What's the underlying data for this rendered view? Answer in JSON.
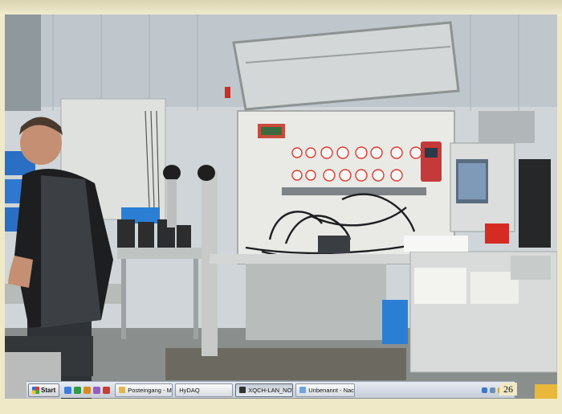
{
  "taskbar": {
    "start_label": "Start",
    "buttons": [
      {
        "label": "Posteingang - Mic...",
        "icon": "folder-icon",
        "active": false
      },
      {
        "label": "HyDAQ",
        "icon": "app-icon",
        "active": false
      },
      {
        "label": "XQCH-LAN_NOV...",
        "icon": "play-icon",
        "active": true
      },
      {
        "label": "Unbenannt - Nac...",
        "icon": "notepad-icon",
        "active": false
      }
    ]
  },
  "page_number": "26",
  "colors": {
    "slide_background": "#efe9c8",
    "taskbar": "#d3d9e2",
    "test_bench_panel": "#e9eae6",
    "gauge_rim": "#e03a2e",
    "crate_blue": "#2a7fd4"
  }
}
